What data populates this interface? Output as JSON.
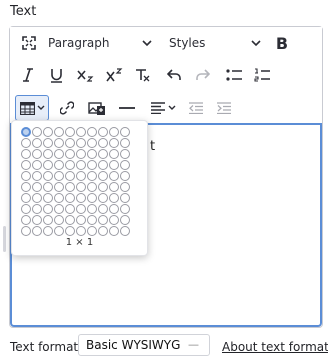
{
  "field": {
    "label": "Text"
  },
  "toolbar": {
    "paragraph_label": "Paragraph",
    "styles_label": "Styles",
    "bold_label": "B",
    "icons": [
      "fullscreen-icon",
      "bold-icon",
      "italic-icon",
      "underline-icon",
      "subscript-icon",
      "superscript-icon",
      "remove-format-icon",
      "undo-icon",
      "redo-icon",
      "bulleted-list-icon",
      "numbered-list-icon",
      "table-icon",
      "link-icon",
      "image-icon",
      "horizontal-line-icon",
      "align-icon",
      "outdent-icon",
      "indent-icon"
    ]
  },
  "editor": {
    "content_text": "t"
  },
  "table_picker": {
    "size_label": "1 × 1",
    "rows": 10,
    "cols": 10,
    "selected": [
      1,
      1
    ]
  },
  "footer": {
    "format_label": "Text format",
    "format_value": "Basic WYSIWYG",
    "about_link": "About text formats"
  },
  "colors": {
    "accent": "#5b8dd6",
    "accent_light": "#e7eef9"
  }
}
